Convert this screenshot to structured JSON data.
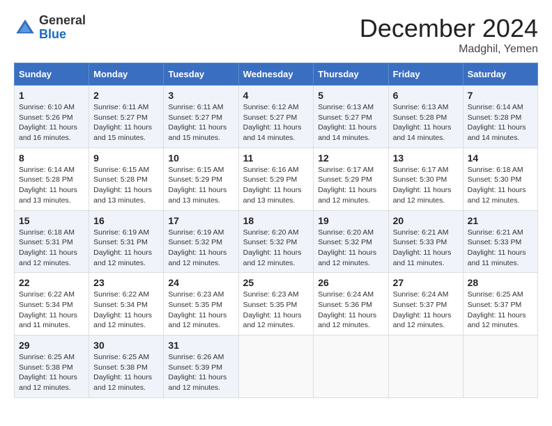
{
  "header": {
    "logo_general": "General",
    "logo_blue": "Blue",
    "month_title": "December 2024",
    "location": "Madghil, Yemen"
  },
  "days_of_week": [
    "Sunday",
    "Monday",
    "Tuesday",
    "Wednesday",
    "Thursday",
    "Friday",
    "Saturday"
  ],
  "weeks": [
    [
      {
        "day": "1",
        "sunrise": "6:10 AM",
        "sunset": "5:26 PM",
        "daylight": "11 hours and 16 minutes."
      },
      {
        "day": "2",
        "sunrise": "6:11 AM",
        "sunset": "5:27 PM",
        "daylight": "11 hours and 15 minutes."
      },
      {
        "day": "3",
        "sunrise": "6:11 AM",
        "sunset": "5:27 PM",
        "daylight": "11 hours and 15 minutes."
      },
      {
        "day": "4",
        "sunrise": "6:12 AM",
        "sunset": "5:27 PM",
        "daylight": "11 hours and 14 minutes."
      },
      {
        "day": "5",
        "sunrise": "6:13 AM",
        "sunset": "5:27 PM",
        "daylight": "11 hours and 14 minutes."
      },
      {
        "day": "6",
        "sunrise": "6:13 AM",
        "sunset": "5:28 PM",
        "daylight": "11 hours and 14 minutes."
      },
      {
        "day": "7",
        "sunrise": "6:14 AM",
        "sunset": "5:28 PM",
        "daylight": "11 hours and 14 minutes."
      }
    ],
    [
      {
        "day": "8",
        "sunrise": "6:14 AM",
        "sunset": "5:28 PM",
        "daylight": "11 hours and 13 minutes."
      },
      {
        "day": "9",
        "sunrise": "6:15 AM",
        "sunset": "5:28 PM",
        "daylight": "11 hours and 13 minutes."
      },
      {
        "day": "10",
        "sunrise": "6:15 AM",
        "sunset": "5:29 PM",
        "daylight": "11 hours and 13 minutes."
      },
      {
        "day": "11",
        "sunrise": "6:16 AM",
        "sunset": "5:29 PM",
        "daylight": "11 hours and 13 minutes."
      },
      {
        "day": "12",
        "sunrise": "6:17 AM",
        "sunset": "5:29 PM",
        "daylight": "11 hours and 12 minutes."
      },
      {
        "day": "13",
        "sunrise": "6:17 AM",
        "sunset": "5:30 PM",
        "daylight": "11 hours and 12 minutes."
      },
      {
        "day": "14",
        "sunrise": "6:18 AM",
        "sunset": "5:30 PM",
        "daylight": "11 hours and 12 minutes."
      }
    ],
    [
      {
        "day": "15",
        "sunrise": "6:18 AM",
        "sunset": "5:31 PM",
        "daylight": "11 hours and 12 minutes."
      },
      {
        "day": "16",
        "sunrise": "6:19 AM",
        "sunset": "5:31 PM",
        "daylight": "11 hours and 12 minutes."
      },
      {
        "day": "17",
        "sunrise": "6:19 AM",
        "sunset": "5:32 PM",
        "daylight": "11 hours and 12 minutes."
      },
      {
        "day": "18",
        "sunrise": "6:20 AM",
        "sunset": "5:32 PM",
        "daylight": "11 hours and 12 minutes."
      },
      {
        "day": "19",
        "sunrise": "6:20 AM",
        "sunset": "5:32 PM",
        "daylight": "11 hours and 12 minutes."
      },
      {
        "day": "20",
        "sunrise": "6:21 AM",
        "sunset": "5:33 PM",
        "daylight": "11 hours and 11 minutes."
      },
      {
        "day": "21",
        "sunrise": "6:21 AM",
        "sunset": "5:33 PM",
        "daylight": "11 hours and 11 minutes."
      }
    ],
    [
      {
        "day": "22",
        "sunrise": "6:22 AM",
        "sunset": "5:34 PM",
        "daylight": "11 hours and 11 minutes."
      },
      {
        "day": "23",
        "sunrise": "6:22 AM",
        "sunset": "5:34 PM",
        "daylight": "11 hours and 12 minutes."
      },
      {
        "day": "24",
        "sunrise": "6:23 AM",
        "sunset": "5:35 PM",
        "daylight": "11 hours and 12 minutes."
      },
      {
        "day": "25",
        "sunrise": "6:23 AM",
        "sunset": "5:35 PM",
        "daylight": "11 hours and 12 minutes."
      },
      {
        "day": "26",
        "sunrise": "6:24 AM",
        "sunset": "5:36 PM",
        "daylight": "11 hours and 12 minutes."
      },
      {
        "day": "27",
        "sunrise": "6:24 AM",
        "sunset": "5:37 PM",
        "daylight": "11 hours and 12 minutes."
      },
      {
        "day": "28",
        "sunrise": "6:25 AM",
        "sunset": "5:37 PM",
        "daylight": "11 hours and 12 minutes."
      }
    ],
    [
      {
        "day": "29",
        "sunrise": "6:25 AM",
        "sunset": "5:38 PM",
        "daylight": "11 hours and 12 minutes."
      },
      {
        "day": "30",
        "sunrise": "6:25 AM",
        "sunset": "5:38 PM",
        "daylight": "11 hours and 12 minutes."
      },
      {
        "day": "31",
        "sunrise": "6:26 AM",
        "sunset": "5:39 PM",
        "daylight": "11 hours and 12 minutes."
      },
      null,
      null,
      null,
      null
    ]
  ],
  "labels": {
    "sunrise": "Sunrise: ",
    "sunset": "Sunset: ",
    "daylight": "Daylight: "
  }
}
